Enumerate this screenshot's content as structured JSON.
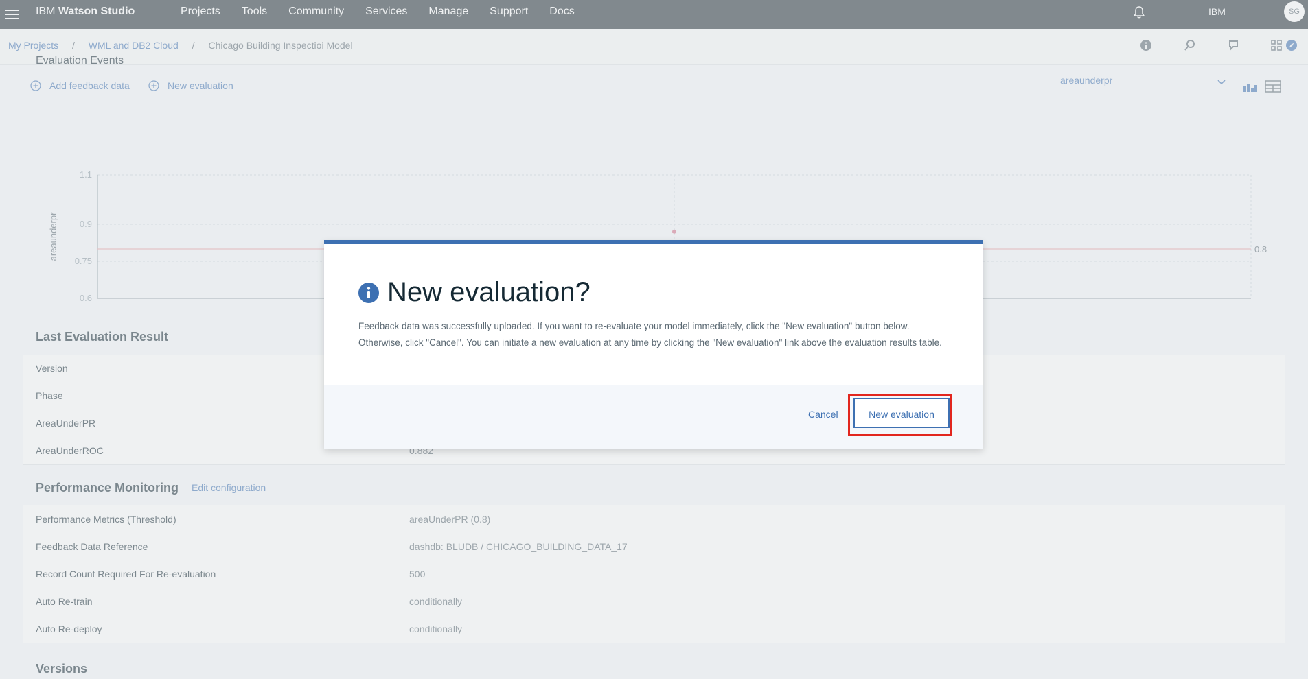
{
  "app": {
    "brand_prefix": "IBM",
    "brand_name": "Watson Studio",
    "nav": [
      "Projects",
      "Tools",
      "Community",
      "Services",
      "Manage",
      "Support",
      "Docs"
    ],
    "account": "IBM",
    "avatar_initials": "SG"
  },
  "breadcrumb": {
    "items": [
      "My Projects",
      "WML and DB2 Cloud"
    ],
    "current": "Chicago Building Inspectioi Model",
    "separator": "/"
  },
  "evaluation": {
    "section_title_partial": "Evaluation Events",
    "add_feedback_label": "Add feedback data",
    "new_evaluation_link": "New evaluation",
    "metric_selected": "areaunderpr"
  },
  "chart_data": {
    "type": "scatter",
    "ylabel": "areaunderpr",
    "yticks": [
      "1.1",
      "0.9",
      "0.75",
      "0.6"
    ],
    "ylim": [
      0.6,
      1.1
    ],
    "x": [
      0.5
    ],
    "y": [
      0.87
    ],
    "threshold": {
      "value": 0.8,
      "label": "0.8"
    },
    "grid": true
  },
  "last_result": {
    "title": "Last Evaluation Result",
    "rows": [
      {
        "key": "Version",
        "value": ""
      },
      {
        "key": "Phase",
        "value": ""
      },
      {
        "key": "AreaUnderPR",
        "value": ""
      },
      {
        "key": "AreaUnderROC",
        "value": "0.882"
      }
    ]
  },
  "performance": {
    "title": "Performance Monitoring",
    "edit_label": "Edit configuration",
    "rows": [
      {
        "key": "Performance Metrics (Threshold)",
        "value": "areaUnderPR (0.8)"
      },
      {
        "key": "Feedback Data Reference",
        "value": "dashdb: BLUDB / CHICAGO_BUILDING_DATA_17"
      },
      {
        "key": "Record Count Required For Re-evaluation",
        "value": "500"
      },
      {
        "key": "Auto Re-train",
        "value": "conditionally"
      },
      {
        "key": "Auto Re-deploy",
        "value": "conditionally"
      }
    ]
  },
  "versions": {
    "title": "Versions"
  },
  "modal": {
    "title": "New evaluation?",
    "body": "Feedback data was successfully uploaded. If you want to re-evaluate your model immediately, click the \"New evaluation\" button below. Otherwise, click \"Cancel\". You can initiate a new evaluation at any time by clicking the \"New evaluation\" link above the evaluation results table.",
    "cancel_label": "Cancel",
    "confirm_label": "New evaluation"
  },
  "colors": {
    "accent": "#3d70b2",
    "highlight": "#e2261e",
    "threshold": "#e8a3a8",
    "point": "#d4718a"
  }
}
